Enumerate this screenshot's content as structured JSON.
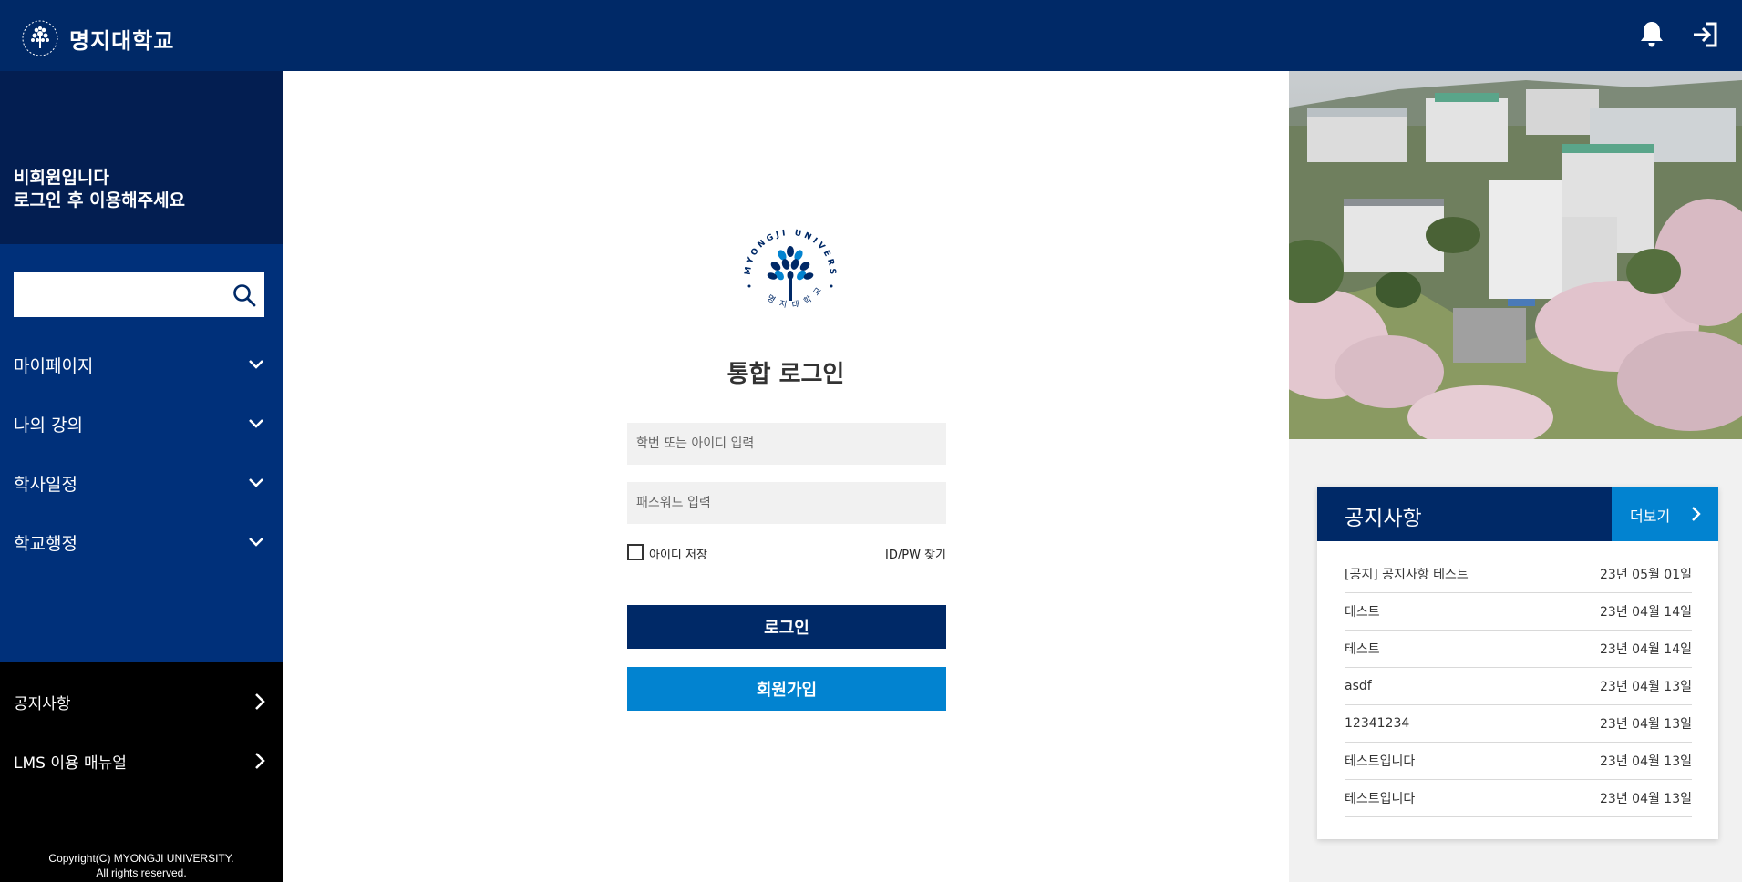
{
  "header": {
    "university_name": "명지대학교",
    "icons": [
      "bell-icon",
      "sign-in-icon"
    ]
  },
  "sidebar": {
    "profile_line1": "비회원입니다",
    "profile_line2": "로그인 후 이용해주세요",
    "search": {
      "placeholder": "",
      "icon": "search-icon"
    },
    "menu": [
      {
        "label": "마이페이지",
        "icon": "chevron-down-icon"
      },
      {
        "label": "나의 강의",
        "icon": "chevron-down-icon"
      },
      {
        "label": "학사일정",
        "icon": "chevron-down-icon"
      },
      {
        "label": "학교행정",
        "icon": "chevron-down-icon"
      }
    ],
    "links": [
      {
        "label": "공지사항",
        "icon": "chevron-right-icon"
      },
      {
        "label": "LMS 이용 매뉴얼",
        "icon": "chevron-right-icon"
      }
    ],
    "copyright_line1": "Copyright(C) MYONGJI UNIVERSITY.",
    "copyright_line2": "All rights reserved."
  },
  "login": {
    "emblem_text_top": "MYONGJI UNIVERSITY",
    "emblem_text_bottom": "명 지 대 학 교",
    "title": "통합 로그인",
    "id_placeholder": "학번 또는 아이디 입력",
    "id_value": "",
    "pw_placeholder": "패스워드 입력",
    "pw_value": "",
    "remember_label": "아이디 저장",
    "remember_checked": false,
    "find_label": "ID/PW 찾기",
    "login_button": "로그인",
    "signup_button": "회원가입"
  },
  "notice": {
    "title": "공지사항",
    "more_label": "더보기",
    "items": [
      {
        "title": "[공지] 공지사항 테스트",
        "date": "23년 05월 01일"
      },
      {
        "title": "테스트",
        "date": "23년 04월 14일"
      },
      {
        "title": "테스트",
        "date": "23년 04월 14일"
      },
      {
        "title": "asdf",
        "date": "23년 04월 13일"
      },
      {
        "title": "12341234",
        "date": "23년 04월 13일"
      },
      {
        "title": "테스트입니다",
        "date": "23년 04월 13일"
      },
      {
        "title": "테스트입니다",
        "date": "23년 04월 13일"
      }
    ]
  },
  "colors": {
    "navy": "#002967",
    "profile_bg": "#031e51",
    "nav_blue": "#00307a",
    "accent_blue": "#0283d0",
    "sidebar_black": "#000000",
    "panel_gray": "#f1f1f1"
  }
}
